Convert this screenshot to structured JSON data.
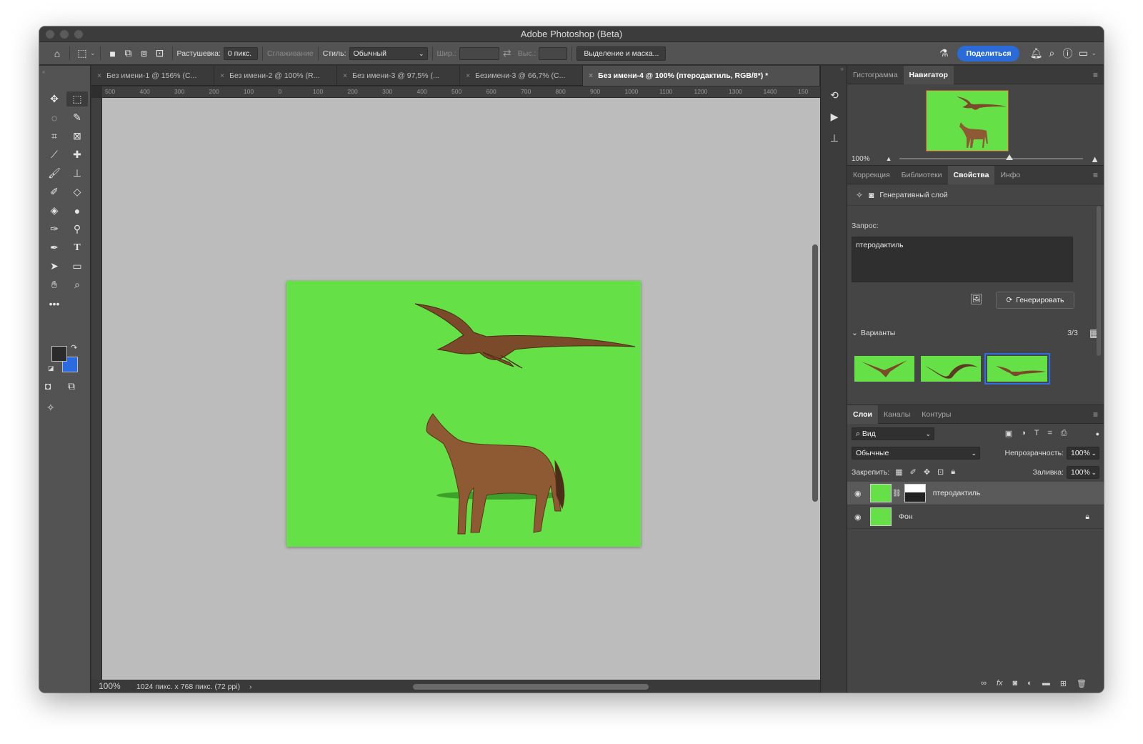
{
  "window": {
    "title": "Adobe Photoshop (Beta)"
  },
  "options": {
    "feather_label": "Растушевка:",
    "feather_value": "0 пикс.",
    "antialias_label": "Сглаживание",
    "style_label": "Стиль:",
    "style_value": "Обычный",
    "width_label": "Шир.:",
    "height_label": "Выс.:",
    "mask_button": "Выделение и маска...",
    "share_button": "Поделиться"
  },
  "tabs": [
    {
      "label": "Без имени-1 @ 156% (С..."
    },
    {
      "label": "Без имени-2 @ 100% (R..."
    },
    {
      "label": "Без имени-3 @ 97,5% (..."
    },
    {
      "label": "Безимени-3 @ 66,7% (С..."
    },
    {
      "label": "Без имени-4 @ 100% (птеродактиль, RGB/8*) *"
    }
  ],
  "ruler": [
    "500",
    "400",
    "300",
    "200",
    "100",
    "0",
    "100",
    "200",
    "300",
    "400",
    "500",
    "600",
    "700",
    "800",
    "900",
    "1000",
    "1100",
    "1200",
    "1300",
    "1400",
    "150"
  ],
  "status": {
    "zoom": "100%",
    "doc_info": "1024 пикс. x 768 пикс. (72 ppi)"
  },
  "navigator": {
    "tabs": [
      "Гистограмма",
      "Навигатор"
    ],
    "zoom": "100%"
  },
  "properties": {
    "tabs": [
      "Коррекция",
      "Библиотеки",
      "Свойства",
      "Инфо"
    ],
    "layer_type": "Генеративный слой",
    "prompt_label": "Запрос:",
    "prompt_value": "птеродактиль",
    "generate_button": "Генерировать",
    "variants_label": "Варианты",
    "variants_count": "3/3"
  },
  "layers": {
    "tabs": [
      "Слои",
      "Каналы",
      "Контуры"
    ],
    "filter": "Вид",
    "blend_mode": "Обычные",
    "opacity_label": "Непрозрачность:",
    "opacity_value": "100%",
    "lock_label": "Закрепить:",
    "fill_label": "Заливка:",
    "fill_value": "100%",
    "items": [
      {
        "name": "птеродактиль"
      },
      {
        "name": "Фон"
      }
    ]
  },
  "colors": {
    "canvas_green": "#65e046",
    "accent_blue": "#2a6bd8"
  }
}
